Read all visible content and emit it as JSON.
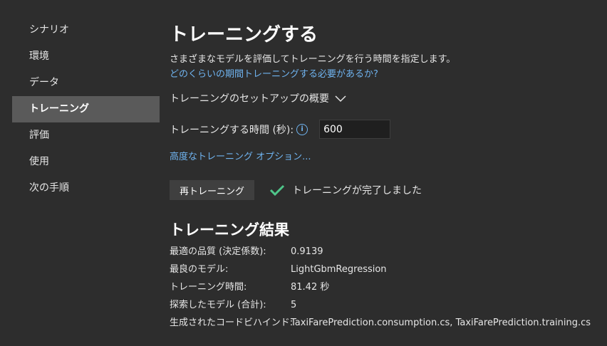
{
  "sidebar": {
    "items": [
      {
        "label": "シナリオ",
        "active": false
      },
      {
        "label": "環境",
        "active": false
      },
      {
        "label": "データ",
        "active": false
      },
      {
        "label": "トレーニング",
        "active": true
      },
      {
        "label": "評価",
        "active": false
      },
      {
        "label": "使用",
        "active": false
      },
      {
        "label": "次の手順",
        "active": false
      }
    ]
  },
  "main": {
    "title": "トレーニングする",
    "description": "さまざまなモデルを評価してトレーニングを行う時間を指定します。",
    "help_link": "どのくらいの期間トレーニングする必要があるか?",
    "summary_toggle": "トレーニングのセットアップの概要",
    "time_label": "トレーニングする時間 (秒):",
    "time_value": "600",
    "advanced_link": "高度なトレーニング オプション...",
    "retrain_button": "再トレーニング",
    "status_text": "トレーニングが完了しました",
    "results_title": "トレーニング結果",
    "results": [
      {
        "key": "最適の品質 (決定係数):",
        "value": "0.9139"
      },
      {
        "key": "最良のモデル:",
        "value": "LightGbmRegression"
      },
      {
        "key": "トレーニング時間:",
        "value": "81.42 秒"
      },
      {
        "key": "探索したモデル (合計):",
        "value": "5"
      },
      {
        "key": "生成されたコードビハインド:",
        "value": "TaxiFarePrediction.consumption.cs, TaxiFarePrediction.training.cs"
      }
    ]
  },
  "colors": {
    "background": "#2d2d2d",
    "sidebar_active": "#5a5a5a",
    "link": "#6fb3ef",
    "success_check": "#4fc68a",
    "input_bg": "#1f1f1f"
  },
  "icons": {
    "info": "info-icon",
    "chevron": "chevron-down-icon",
    "check": "checkmark-icon"
  }
}
